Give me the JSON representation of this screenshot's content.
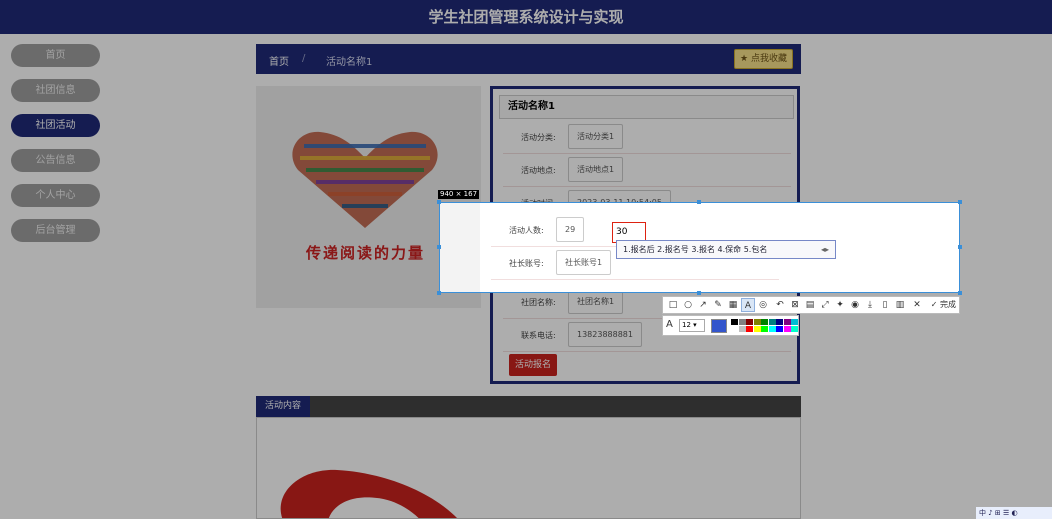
{
  "header": {
    "title": "学生社团管理系统设计与实现"
  },
  "sidebar": {
    "items": [
      {
        "label": "首页",
        "active": false
      },
      {
        "label": "社团信息",
        "active": false
      },
      {
        "label": "社团活动",
        "active": true
      },
      {
        "label": "公告信息",
        "active": false
      },
      {
        "label": "个人中心",
        "active": false
      },
      {
        "label": "后台管理",
        "active": false
      }
    ]
  },
  "breadcrumb": {
    "home": "首页",
    "separator": "/",
    "current": "活动名称1",
    "favorite_label": "点我收藏"
  },
  "image": {
    "caption": "传递阅读的力量"
  },
  "detail": {
    "title": "活动名称1",
    "fields": [
      {
        "label": "活动分类:",
        "value": "活动分类1"
      },
      {
        "label": "活动地点:",
        "value": "活动地点1"
      },
      {
        "label": "活动时间:",
        "value": "2023-03-11 10:54:05"
      },
      {
        "label": "活动人数:",
        "value": "29"
      },
      {
        "label": "社长账号:",
        "value": "社长账号1"
      },
      {
        "label": "社团名称:",
        "value": "社团名称1"
      },
      {
        "label": "联系电话:",
        "value": "13823888881"
      }
    ],
    "signup_label": "活动报名"
  },
  "content": {
    "tab_label": "活动内容"
  },
  "screenshot_tool": {
    "size_label": "940 × 167",
    "edit_value": "30",
    "ime_candidates": "1.报名后 2.报名号 3.报名 4.保命 5.包名",
    "done_label": "完成",
    "font_size": "12",
    "current_color": "#3355cc",
    "palette": [
      "#000000",
      "#808080",
      "#800000",
      "#808000",
      "#008000",
      "#008080",
      "#000080",
      "#800080",
      "#00bcd4",
      "#ffffff",
      "#c0c0c0",
      "#ff0000",
      "#ffff00",
      "#00ff00",
      "#00ffff",
      "#0000ff",
      "#ff00ff",
      "#00ffcc"
    ]
  },
  "taskbar": {
    "text": "中 ♪ ⊞ ☰ ◐"
  }
}
